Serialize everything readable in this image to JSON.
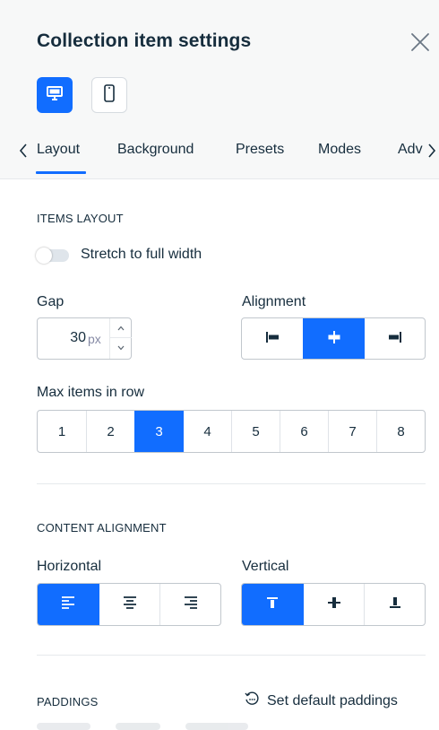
{
  "panel": {
    "title": "Collection item settings",
    "close_icon": "close-icon",
    "device_modes": [
      {
        "name": "desktop",
        "icon": "desktop-icon",
        "active": true
      },
      {
        "name": "mobile",
        "icon": "mobile-icon",
        "active": false
      }
    ]
  },
  "tabs": {
    "items": [
      "Layout",
      "Background",
      "Presets",
      "Modes",
      "Adv"
    ],
    "active": "Layout",
    "prev_icon": "chevron-left-icon",
    "next_icon": "chevron-right-icon"
  },
  "items_layout": {
    "heading": "ITEMS LAYOUT",
    "stretch_label": "Stretch to full width",
    "stretch_on": false,
    "gap_label": "Gap",
    "gap_value": "30",
    "gap_unit": "px",
    "alignment_label": "Alignment",
    "alignment_options": [
      "align-left-icon",
      "align-center-icon",
      "align-right-icon"
    ],
    "alignment_selected": "align-center-icon",
    "max_items_label": "Max items in row",
    "max_items_options": [
      "1",
      "2",
      "3",
      "4",
      "5",
      "6",
      "7",
      "8"
    ],
    "max_items_selected": "3"
  },
  "content_alignment": {
    "heading": "CONTENT ALIGNMENT",
    "horizontal_label": "Horizontal",
    "horizontal_options": [
      "text-align-left-icon",
      "text-align-center-icon",
      "text-align-right-icon"
    ],
    "horizontal_selected": "text-align-left-icon",
    "vertical_label": "Vertical",
    "vertical_options": [
      "align-top-icon",
      "align-middle-icon",
      "align-bottom-icon"
    ],
    "vertical_selected": "align-top-icon"
  },
  "paddings": {
    "heading": "PADDINGS",
    "reset_label": "Set default paddings",
    "reset_icon": "reset-icon"
  },
  "colors": {
    "accent": "#116dff",
    "text": "#162d3d",
    "header_bg": "#f7f8f8"
  }
}
